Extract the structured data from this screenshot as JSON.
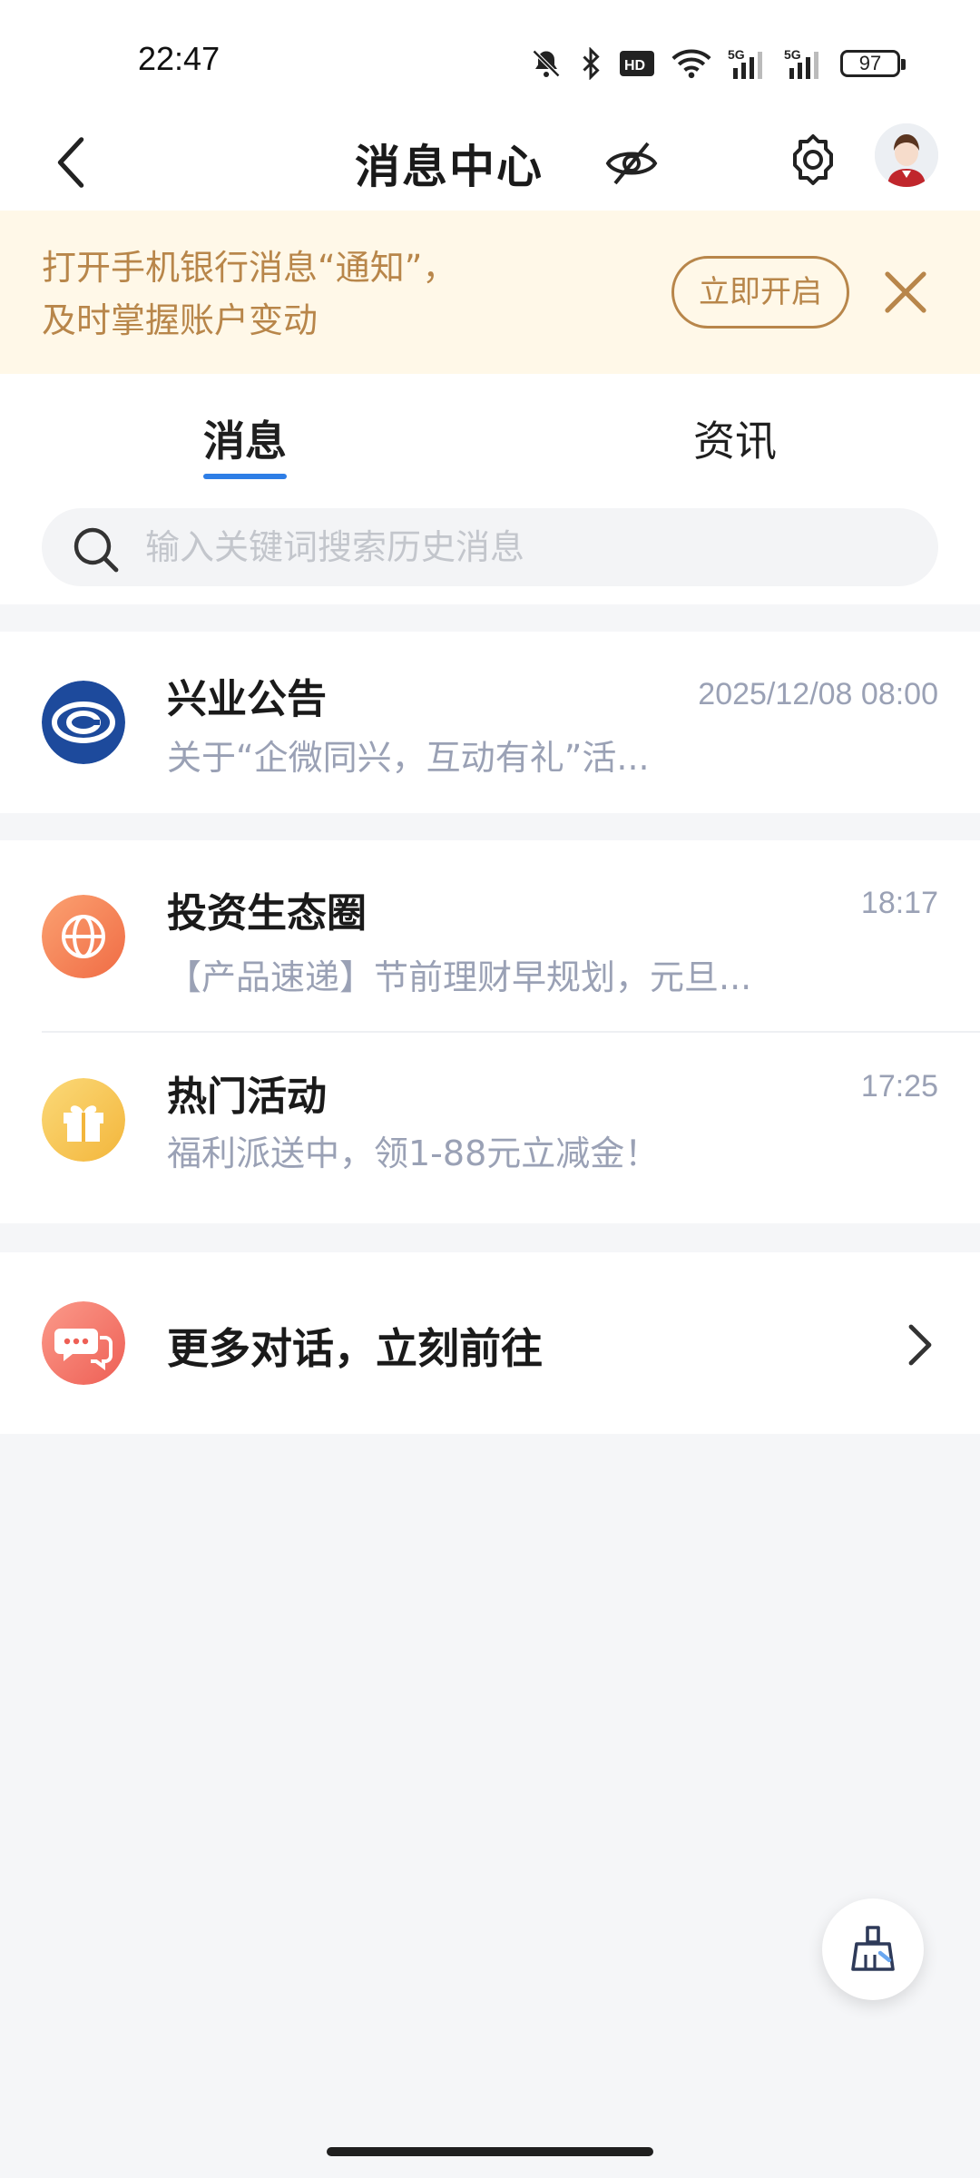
{
  "status_bar": {
    "time": "22:47",
    "battery": "97",
    "icons": [
      "bell-off-icon",
      "bluetooth-icon",
      "hd-icon",
      "wifi-icon",
      "signal-5g-icon",
      "signal-5g-icon",
      "battery-icon"
    ]
  },
  "nav": {
    "title": "消息中心",
    "icons": [
      "back-icon",
      "eye-off-icon",
      "gear-icon",
      "avatar"
    ]
  },
  "banner": {
    "line1": "打开手机银行消息“通知”，",
    "line2": "及时掌握账户变动",
    "button": "立即开启",
    "accent": "#b8864a",
    "background": "#fff8e8"
  },
  "tabs": {
    "items": [
      "消息",
      "资讯"
    ],
    "active": "消息",
    "accent": "#2e7ee6"
  },
  "search": {
    "placeholder": "输入关键词搜索历史消息"
  },
  "messages": [
    {
      "title": "兴业公告",
      "time": "2025/12/08 08:00",
      "preview": "关于“企微同兴，互动有礼”活...",
      "icon": "cib-logo-icon",
      "icon_color": "#1d4a9c"
    },
    {
      "title": "投资生态圈",
      "time": "18:17",
      "preview": "【产品速递】节前理财早规划，元旦...",
      "icon": "globe-icon",
      "icon_color": "#f5865a"
    },
    {
      "title": "热门活动",
      "time": "17:25",
      "preview": "福利派送中，领1-88元立减金！",
      "icon": "gift-icon",
      "icon_color": "#f6c453"
    }
  ],
  "more": {
    "label": "更多对话，立刻前往",
    "icon": "chat-bubbles-icon",
    "icon_color": "#f27a6e"
  },
  "fab": {
    "icon": "broom-icon"
  }
}
